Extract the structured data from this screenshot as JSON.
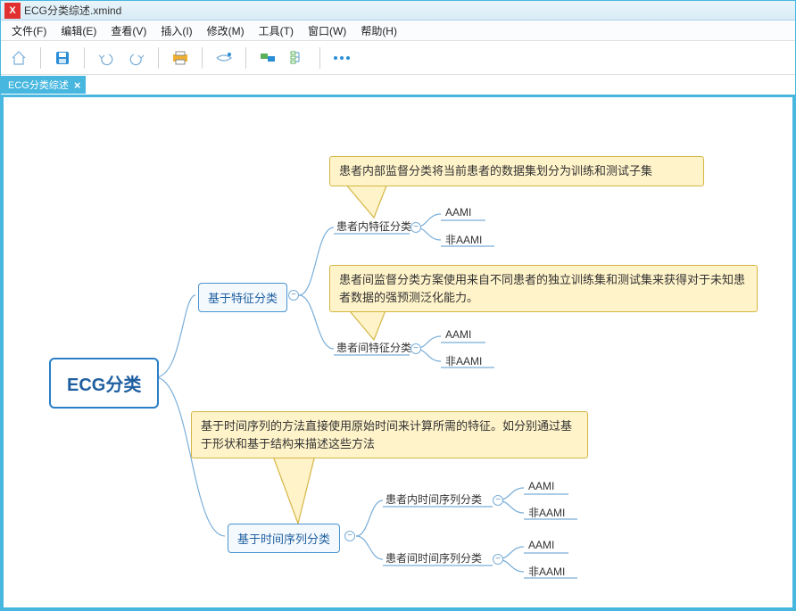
{
  "window": {
    "title": "ECG分类综述.xmind"
  },
  "menu": {
    "file": "文件(F)",
    "edit": "编辑(E)",
    "view": "查看(V)",
    "insert": "插入(I)",
    "modify": "修改(M)",
    "tools": "工具(T)",
    "window": "窗口(W)",
    "help": "帮助(H)"
  },
  "tab": {
    "label": "ECG分类综述"
  },
  "root": "ECG分类",
  "branch1": {
    "label": "基于特征分类",
    "sub1": {
      "label": "患者内特征分类",
      "leaf1": "AAMI",
      "leaf2": "非AAMI"
    },
    "sub2": {
      "label": "患者间特征分类",
      "leaf1": "AAMI",
      "leaf2": "非AAMI"
    },
    "note1": "患者内部监督分类将当前患者的数据集划分为训练和测试子集",
    "note2": "患者间监督分类方案使用来自不同患者的独立训练集和测试集来获得对于未知患者数据的强预测泛化能力。"
  },
  "branch2": {
    "label": "基于时间序列分类",
    "sub1": {
      "label": "患者内时间序列分类",
      "leaf1": "AAMI",
      "leaf2": "非AAMI"
    },
    "sub2": {
      "label": "患者间时间序列分类",
      "leaf1": "AAMI",
      "leaf2": "非AAMI"
    },
    "note": "基于时间序列的方法直接使用原始时间来计算所需的特征。如分别通过基于形状和基于结构来描述这些方法"
  },
  "chart_data": {
    "type": "mindmap",
    "root": "ECG分类",
    "children": [
      {
        "label": "基于特征分类",
        "note": "患者内部监督分类将当前患者的数据集划分为训练和测试子集 / 患者间监督分类方案使用来自不同患者的独立训练集和测试集来获得对于未知患者数据的强预测泛化能力。",
        "children": [
          {
            "label": "患者内特征分类",
            "children": [
              {
                "label": "AAMI"
              },
              {
                "label": "非AAMI"
              }
            ]
          },
          {
            "label": "患者间特征分类",
            "children": [
              {
                "label": "AAMI"
              },
              {
                "label": "非AAMI"
              }
            ]
          }
        ]
      },
      {
        "label": "基于时间序列分类",
        "note": "基于时间序列的方法直接使用原始时间来计算所需的特征。如分别通过基于形状和基于结构来描述这些方法",
        "children": [
          {
            "label": "患者内时间序列分类",
            "children": [
              {
                "label": "AAMI"
              },
              {
                "label": "非AAMI"
              }
            ]
          },
          {
            "label": "患者间时间序列分类",
            "children": [
              {
                "label": "AAMI"
              },
              {
                "label": "非AAMI"
              }
            ]
          }
        ]
      }
    ]
  }
}
